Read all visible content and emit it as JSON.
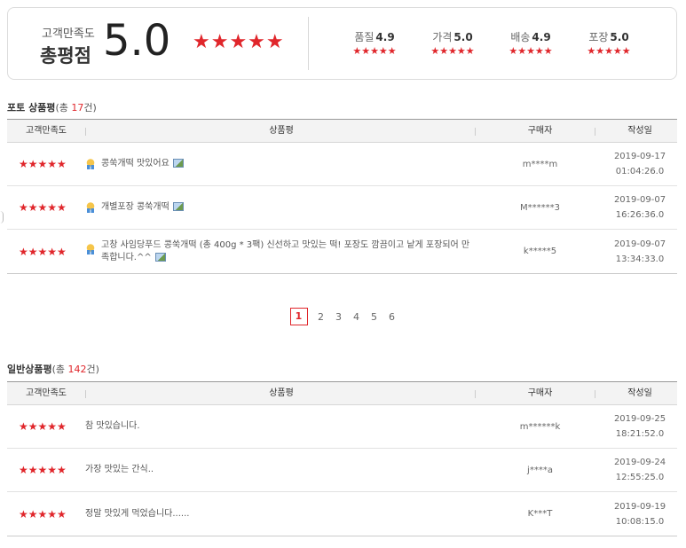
{
  "summary": {
    "label": "고객만족도",
    "title": "총평점",
    "score": "5.0",
    "stars": "★★★★★",
    "categories": [
      {
        "name": "품질",
        "score": "4.9",
        "stars": "★★★★★"
      },
      {
        "name": "가격",
        "score": "5.0",
        "stars": "★★★★★"
      },
      {
        "name": "배송",
        "score": "4.9",
        "stars": "★★★★★"
      },
      {
        "name": "포장",
        "score": "5.0",
        "stars": "★★★★★"
      }
    ]
  },
  "columns": {
    "rating": "고객만족도",
    "review": "상품평",
    "buyer": "구매자",
    "date": "작성일"
  },
  "photo_reviews": {
    "title": "포토 상품평",
    "count_prefix": "(총 ",
    "count": "17",
    "count_suffix": "건)",
    "rows": [
      {
        "stars": "★★★★★",
        "text": "콩쑥개떡 맛있어요",
        "buyer": "m****m",
        "date": "2019-09-17",
        "time": "01:04:26.0"
      },
      {
        "stars": "★★★★★",
        "text": "개별포장 콩쑥개떡",
        "buyer": "M******3",
        "date": "2019-09-07",
        "time": "16:26:36.0"
      },
      {
        "stars": "★★★★★",
        "text": "고창 사임당푸드 콩쑥개떡 (총 400g * 3팩) 신선하고 맛있는 떡! 포장도 깜끔이고 낱게 포장되어 만족합니다.^^",
        "buyer": "k*****5",
        "date": "2019-09-07",
        "time": "13:34:33.0"
      }
    ]
  },
  "pagination": {
    "pages": [
      "1",
      "2",
      "3",
      "4",
      "5",
      "6"
    ],
    "current": "1"
  },
  "general_reviews": {
    "title": "일반상품평",
    "count_prefix": "(총 ",
    "count": "142",
    "count_suffix": "건)",
    "rows": [
      {
        "stars": "★★★★★",
        "text": "참 맛있습니다.",
        "buyer": "m******k",
        "date": "2019-09-25",
        "time": "18:21:52.0"
      },
      {
        "stars": "★★★★★",
        "text": "가장 맛있는 간식..",
        "buyer": "j****a",
        "date": "2019-09-24",
        "time": "12:55:25.0"
      },
      {
        "stars": "★★★★★",
        "text": "정말 맛있게 먹었습니다......",
        "buyer": "K***T",
        "date": "2019-09-19",
        "time": "10:08:15.0"
      }
    ]
  },
  "colors": {
    "accent": "#e0262b",
    "header_bg": "#f3f3f3"
  }
}
